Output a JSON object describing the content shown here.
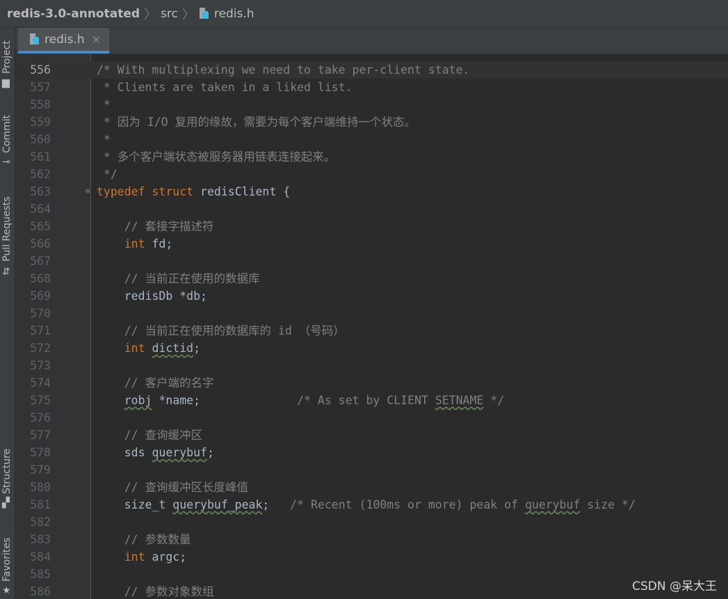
{
  "breadcrumb": {
    "project": "redis-3.0-annotated",
    "folder": "src",
    "file": "redis.h"
  },
  "tab": {
    "label": "redis.h",
    "close": "×"
  },
  "side_tabs": {
    "project": "Project",
    "commit": "Commit",
    "pull_requests": "Pull Requests",
    "structure": "Structure",
    "favorites": "Favorites"
  },
  "editor": {
    "current_line": "556",
    "lines": [
      {
        "num": "556",
        "segments": [
          {
            "t": "c",
            "s": "/* With multiplexing we need to take per-client state."
          }
        ]
      },
      {
        "num": "557",
        "segments": [
          {
            "t": "c",
            "s": " * Clients are taken in a liked list."
          }
        ]
      },
      {
        "num": "558",
        "segments": [
          {
            "t": "c",
            "s": " *"
          }
        ]
      },
      {
        "num": "559",
        "segments": [
          {
            "t": "c",
            "s": " * 因为 I/O 复用的缘故，需要为每个客户端维持一个状态。"
          }
        ]
      },
      {
        "num": "560",
        "segments": [
          {
            "t": "c",
            "s": " *"
          }
        ]
      },
      {
        "num": "561",
        "segments": [
          {
            "t": "c",
            "s": " * 多个客户端状态被服务器用链表连接起来。"
          }
        ]
      },
      {
        "num": "562",
        "segments": [
          {
            "t": "c",
            "s": " */"
          }
        ]
      },
      {
        "num": "563",
        "segments": [
          {
            "t": "k",
            "s": "typedef "
          },
          {
            "t": "k",
            "s": "struct "
          },
          {
            "t": "i",
            "s": "redisClient {"
          }
        ]
      },
      {
        "num": "564",
        "segments": []
      },
      {
        "num": "565",
        "segments": [
          {
            "t": "c",
            "s": "    // 套接字描述符"
          }
        ]
      },
      {
        "num": "566",
        "segments": [
          {
            "t": "k",
            "s": "    int "
          },
          {
            "t": "i",
            "s": "fd;"
          }
        ]
      },
      {
        "num": "567",
        "segments": []
      },
      {
        "num": "568",
        "segments": [
          {
            "t": "c",
            "s": "    // 当前正在使用的数据库"
          }
        ]
      },
      {
        "num": "569",
        "segments": [
          {
            "t": "i",
            "s": "    redisDb *db;"
          }
        ]
      },
      {
        "num": "570",
        "segments": []
      },
      {
        "num": "571",
        "segments": [
          {
            "t": "c",
            "s": "    // 当前正在使用的数据库的 id （号码）"
          }
        ]
      },
      {
        "num": "572",
        "segments": [
          {
            "t": "k",
            "s": "    int "
          },
          {
            "t": "iw",
            "s": "dictid"
          },
          {
            "t": "i",
            "s": ";"
          }
        ]
      },
      {
        "num": "573",
        "segments": []
      },
      {
        "num": "574",
        "segments": [
          {
            "t": "c",
            "s": "    // 客户端的名字"
          }
        ]
      },
      {
        "num": "575",
        "segments": [
          {
            "t": "i",
            "s": "    "
          },
          {
            "t": "iw",
            "s": "robj"
          },
          {
            "t": "i",
            "s": " *name;              "
          },
          {
            "t": "c",
            "s": "/* As set by CLIENT "
          },
          {
            "t": "cw",
            "s": "SETNAME"
          },
          {
            "t": "c",
            "s": " */"
          }
        ]
      },
      {
        "num": "576",
        "segments": []
      },
      {
        "num": "577",
        "segments": [
          {
            "t": "c",
            "s": "    // 查询缓冲区"
          }
        ]
      },
      {
        "num": "578",
        "segments": [
          {
            "t": "i",
            "s": "    sds "
          },
          {
            "t": "iw",
            "s": "querybuf"
          },
          {
            "t": "i",
            "s": ";"
          }
        ]
      },
      {
        "num": "579",
        "segments": []
      },
      {
        "num": "580",
        "segments": [
          {
            "t": "c",
            "s": "    // 查询缓冲区长度峰值"
          }
        ]
      },
      {
        "num": "581",
        "segments": [
          {
            "t": "i",
            "s": "    size_t "
          },
          {
            "t": "iw",
            "s": "querybuf_peak"
          },
          {
            "t": "i",
            "s": ";   "
          },
          {
            "t": "c",
            "s": "/* Recent (100ms or more) peak of "
          },
          {
            "t": "cw",
            "s": "querybuf"
          },
          {
            "t": "c",
            "s": " size */"
          }
        ]
      },
      {
        "num": "582",
        "segments": []
      },
      {
        "num": "583",
        "segments": [
          {
            "t": "c",
            "s": "    // 参数数量"
          }
        ]
      },
      {
        "num": "584",
        "segments": [
          {
            "t": "k",
            "s": "    int "
          },
          {
            "t": "i",
            "s": "argc;"
          }
        ]
      },
      {
        "num": "585",
        "segments": []
      },
      {
        "num": "586",
        "segments": [
          {
            "t": "c",
            "s": "    // 参数对象数组"
          }
        ]
      }
    ]
  },
  "watermark": "CSDN @呆大王",
  "colors": {
    "keyword": "#cc7832",
    "comment": "#808080",
    "identifier": "#a9b7c6",
    "active_tab_underline": "#4a88c7"
  }
}
